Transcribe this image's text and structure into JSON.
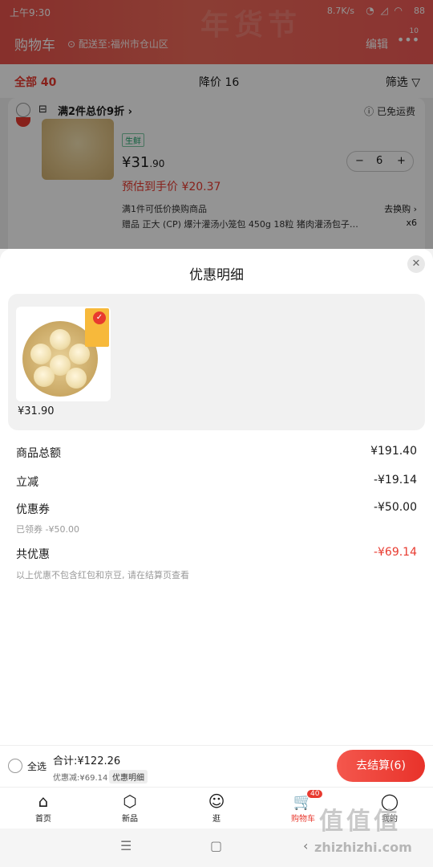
{
  "status": {
    "time": "上午9:30",
    "speed": "8.7K/s",
    "battery": "88"
  },
  "header": {
    "festive_watermark": "年货节",
    "title": "购物车",
    "address": "配送至:福州市仓山区",
    "edit": "编辑",
    "more_count": "10"
  },
  "tabs": {
    "all": "全部 40",
    "price_drop": "降价 16",
    "filter": "筛选"
  },
  "cart_item": {
    "promo": "满2件总价9折",
    "free_shipping": "已免运费",
    "fresh_tag": "生鲜",
    "price_main": "¥31",
    "price_decimal": ".90",
    "qty": "6",
    "estimated": "预估到手价 ¥20.37",
    "swap_text": "满1件可低价换购商品",
    "swap_action": "去换购",
    "gift_text": "赠品 正大 (CP) 爆汁灌汤小笼包 450g 18粒 猪肉灌汤包子…",
    "gift_qty": "x6"
  },
  "sheet": {
    "title": "优惠明细",
    "product_price": "¥31.90",
    "rows": [
      {
        "label": "商品总额",
        "value": "¥191.40"
      },
      {
        "label": "立减",
        "value": "-¥19.14"
      },
      {
        "label": "优惠券",
        "value": "-¥50.00",
        "note": "已领券 -¥50.00"
      },
      {
        "label": "共优惠",
        "value": "-¥69.14"
      }
    ],
    "footnote": "以上优惠不包含红包和京豆, 请在结算页查看"
  },
  "checkout": {
    "select_all": "全选",
    "total": "合计:¥122.26",
    "savings": "优惠减:¥69.14",
    "detail_link": "优惠明细",
    "button": "去结算(6)"
  },
  "tabbar": [
    {
      "label": "首页",
      "icon": "home-icon"
    },
    {
      "label": "新品",
      "icon": "cube-icon"
    },
    {
      "label": "逛",
      "icon": "face-icon"
    },
    {
      "label": "购物车",
      "icon": "cart-icon",
      "badge": "40"
    },
    {
      "label": "我的",
      "icon": "user-icon"
    }
  ],
  "watermark": {
    "logo": "值值值",
    "site": "zhizhizhi.com"
  },
  "colors": {
    "accent": "#e83a2f",
    "header_bg": "#ef5a55"
  }
}
